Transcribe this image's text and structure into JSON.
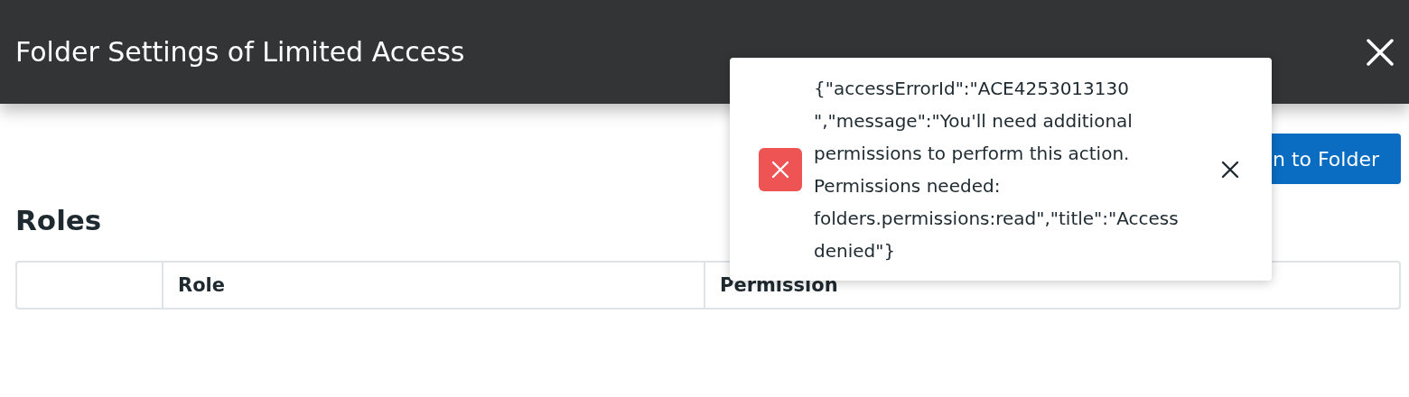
{
  "header": {
    "title": "Folder Settings of Limited Access"
  },
  "toolbar": {
    "button": "n to Folder"
  },
  "roles": {
    "heading": "Roles",
    "columns": [
      {
        "label": "Role"
      },
      {
        "label": "Permission"
      }
    ]
  },
  "toast": {
    "kind": "error",
    "message": "{\"accessErrorId\":\"ACE4253013130 \",\"message\":\"You'll need additional permissions to perform this action. Permissions needed: folders.permissions:read\",\"title\":\"Access denied\"}"
  }
}
